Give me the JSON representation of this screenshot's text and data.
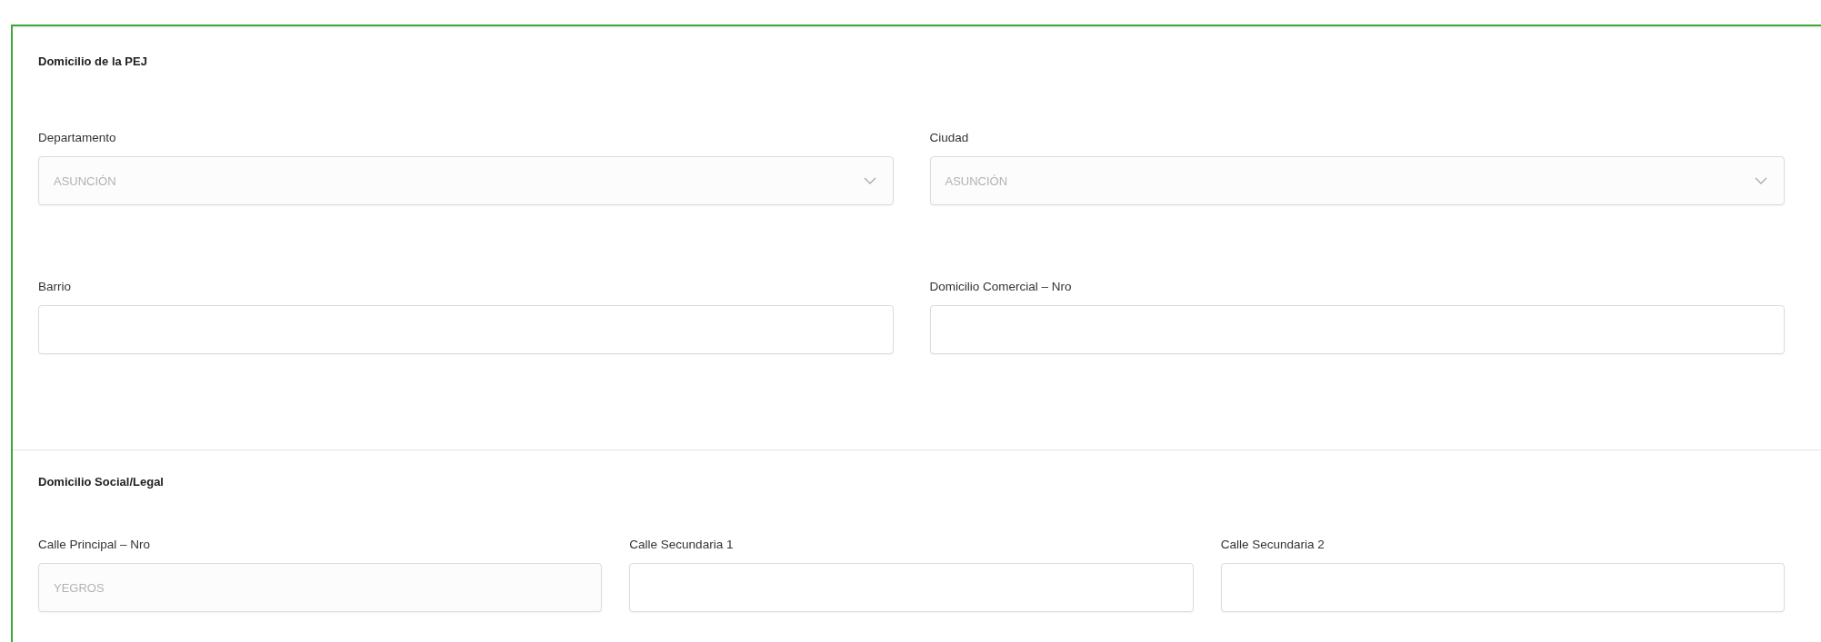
{
  "sections": [
    {
      "title": "Domicilio de la PEJ",
      "rows": [
        [
          {
            "label": "Departamento",
            "kind": "select",
            "value": "ASUNCIÓN",
            "disabled": true
          },
          {
            "label": "Ciudad",
            "kind": "select",
            "value": "ASUNCIÓN",
            "disabled": true
          }
        ],
        [
          {
            "label": "Barrio",
            "kind": "text"
          },
          {
            "label": "Domicilio Comercial – Nro",
            "kind": "text"
          }
        ]
      ]
    },
    {
      "title": "Domicilio Social/Legal",
      "rows": [
        [
          {
            "label": "Calle Principal – Nro",
            "kind": "text",
            "value": "YEGROS",
            "disabled": true
          },
          {
            "label": "Calle Secundaria 1",
            "kind": "text"
          },
          {
            "label": "Calle Secundaria 2",
            "kind": "text"
          }
        ]
      ]
    }
  ]
}
